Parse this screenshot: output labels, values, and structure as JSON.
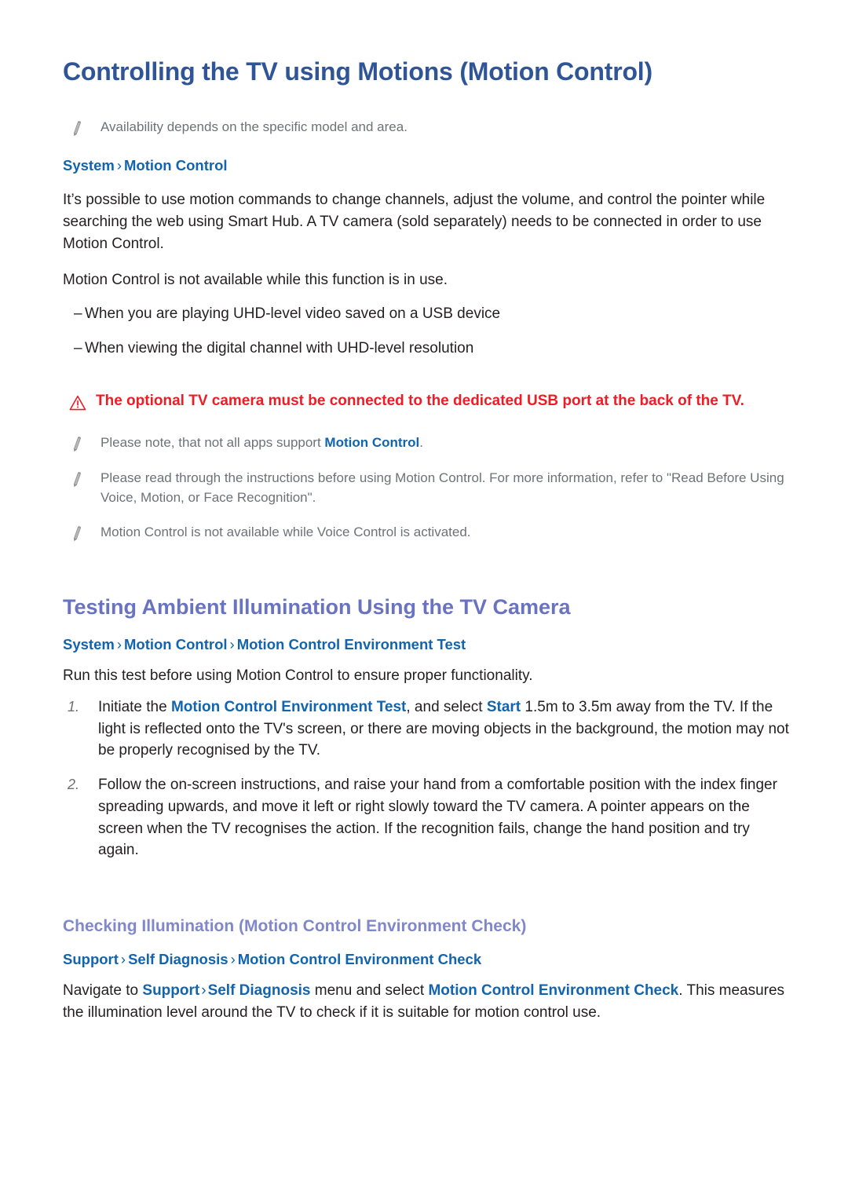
{
  "page": {
    "title": "Controlling the TV using Motions (Motion Control)"
  },
  "colors": {
    "h1": "#2f5597",
    "h2": "#6a73c0",
    "h3": "#8187cb",
    "link": "#1164ad",
    "caution": "#ee1c25",
    "note_text": "#6d7278",
    "body_text": "#231f20"
  },
  "section1": {
    "heading": "Controlling the TV using Motions (Motion Control)",
    "note_availability": "Availability depends on the specific model and area.",
    "breadcrumb": {
      "items": [
        "System",
        "Motion Control"
      ],
      "separator": "›"
    },
    "paragraph1": "It’s possible to use motion commands to change channels, adjust the volume, and control the pointer while searching the web using Smart Hub. A TV camera (sold separately) needs to be connected in order to use Motion Control.",
    "paragraph2": "Motion Control is not available while this function is in use.",
    "dash_marker": "–",
    "dash_items": [
      "When you are playing UHD-level video saved on a USB device",
      "When viewing the digital channel with UHD-level resolution"
    ],
    "caution": "The optional TV camera must be connected to the dedicated USB port at the back of the TV.",
    "notes": [
      {
        "pre": "Please note, that not all apps support ",
        "link": "Motion Control",
        "post": "."
      },
      {
        "pre": "Please read through the instructions before using Motion Control. For more information, refer to \"Read Before Using Voice, Motion, or Face Recognition\".",
        "link": "",
        "post": ""
      },
      {
        "pre": "Motion Control is not available while Voice Control is activated.",
        "link": "",
        "post": ""
      }
    ]
  },
  "section2": {
    "heading": "Testing Ambient Illumination Using the TV Camera",
    "breadcrumb": {
      "items": [
        "System",
        "Motion Control",
        "Motion Control Environment Test"
      ],
      "separator": "›"
    },
    "paragraph": "Run this test before using Motion Control to ensure proper functionality.",
    "steps": [
      {
        "number": "1.",
        "pre": "Initiate the ",
        "link1": "Motion Control Environment Test",
        "mid": ", and select ",
        "link2": "Start",
        "post": " 1.5m to 3.5m away from the TV. If the light is reflected onto the TV's screen, or there are moving objects in the background, the motion may not be properly recognised by the TV."
      },
      {
        "number": "2.",
        "pre": "Follow the on-screen instructions, and raise your hand from a comfortable position with the index finger spreading upwards, and move it left or right slowly toward the TV camera. A pointer appears on the screen when the TV recognises the action. If the recognition fails, change the hand position and try again.",
        "link1": "",
        "mid": "",
        "link2": "",
        "post": ""
      }
    ]
  },
  "section3": {
    "heading": "Checking Illumination (Motion Control Environment Check)",
    "breadcrumb": {
      "items": [
        "Support",
        "Self Diagnosis",
        "Motion Control Environment Check"
      ],
      "separator": "›"
    },
    "paragraph": {
      "t1": "Navigate to ",
      "link1": "Support",
      "sep": "›",
      "link2": "Self Diagnosis",
      "t2": " menu and select ",
      "link3": "Motion Control Environment Check",
      "t3": ". This measures the illumination level around the TV to check if it is suitable for motion control use."
    }
  },
  "icons": {
    "note": "pencil-icon",
    "caution": "warning-triangle-icon"
  }
}
